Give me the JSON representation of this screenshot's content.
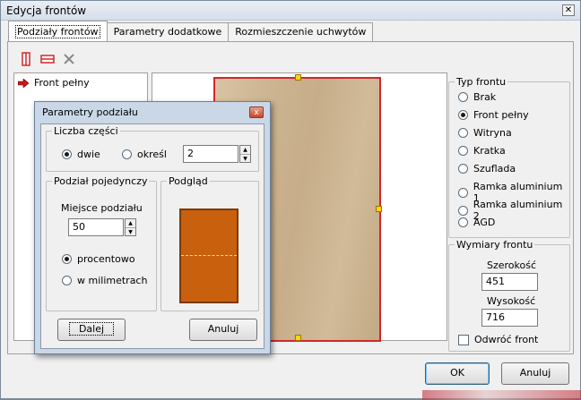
{
  "window": {
    "title": "Edycja frontów",
    "close_glyph": "✕"
  },
  "tabs": [
    {
      "label": "Podziały frontów",
      "active": true
    },
    {
      "label": "Parametry dodatkowe",
      "active": false
    },
    {
      "label": "Rozmieszczenie uchwytów",
      "active": false
    }
  ],
  "toolbar": {
    "items": [
      {
        "icon": "vertical-split-icon",
        "color": "#d2272a"
      },
      {
        "icon": "horizontal-split-icon",
        "color": "#d2272a"
      },
      {
        "icon": "delete-icon",
        "color": "#8a8a8a"
      }
    ]
  },
  "tree": {
    "items": [
      {
        "label": "Front pełny",
        "icon": "red-arrow-icon",
        "color": "#c81818"
      }
    ]
  },
  "front_type": {
    "legend": "Typ frontu",
    "options": [
      {
        "label": "Brak",
        "selected": false
      },
      {
        "label": "Front pełny",
        "selected": true
      },
      {
        "label": "Witryna",
        "selected": false
      },
      {
        "label": "Kratka",
        "selected": false
      },
      {
        "label": "Szuflada",
        "selected": false
      },
      {
        "label": "Ramka aluminium 1",
        "selected": false
      },
      {
        "label": "Ramka aluminium 2",
        "selected": false
      },
      {
        "label": "AGD",
        "selected": false
      }
    ]
  },
  "dimensions": {
    "legend": "Wymiary frontu",
    "width_label": "Szerokość",
    "width_value": "451",
    "height_label": "Wysokość",
    "height_value": "716",
    "flip_label": "Odwróć front",
    "flip_checked": false
  },
  "buttons": {
    "ok": "OK",
    "cancel": "Anuluj"
  },
  "dialog": {
    "title": "Parametry podziału",
    "close_glyph": "x",
    "parts_legend": "Liczba części",
    "parts_option_two": "dwie",
    "parts_option_custom": "określ",
    "parts_value": "2",
    "single_legend": "Podział pojedynczy",
    "position_label": "Miejsce podziału",
    "position_value": "50",
    "percent_label": "procentowo",
    "mm_label": "w milimetrach",
    "preview_legend": "Podgląd",
    "next_button": "Dalej",
    "cancel_button": "Anuluj",
    "accent_color": "#c8600e"
  }
}
